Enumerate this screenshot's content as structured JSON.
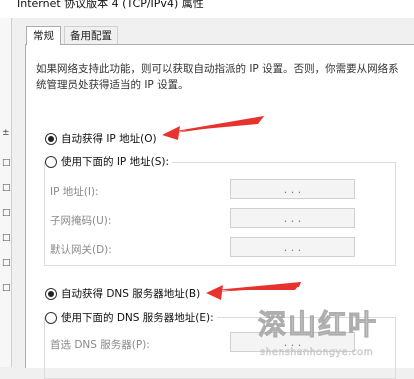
{
  "window": {
    "title": "Internet 协议版本 4 (TCP/IPv4) 属性"
  },
  "tabs": [
    {
      "label": "常规",
      "active": true
    },
    {
      "label": "备用配置",
      "active": false
    }
  ],
  "description": "如果网络支持此功能，则可以获取自动指派的 IP 设置。否则，你需要从网络系统管理员处获得适当的 IP 设置。",
  "ip": {
    "auto_label": "自动获得 IP 地址(O)",
    "auto_selected": true,
    "manual_label": "使用下面的 IP 地址(S):",
    "manual_selected": false,
    "fields": [
      {
        "label": "IP 地址(I):",
        "value": ". . ."
      },
      {
        "label": "子网掩码(U):",
        "value": ". . ."
      },
      {
        "label": "默认网关(D):",
        "value": ". . ."
      }
    ]
  },
  "dns": {
    "auto_label": "自动获得 DNS 服务器地址(B)",
    "auto_selected": true,
    "manual_label": "使用下面的 DNS 服务器地址(E):",
    "manual_selected": false,
    "fields": [
      {
        "label": "首选 DNS 服务器(P):",
        "value": ". . ."
      }
    ]
  },
  "watermark": {
    "logo_text": "深山红叶",
    "url": "shenshanhongye.com"
  },
  "colors": {
    "arrow": "#e8322d",
    "panel_bg": "#ffffff",
    "window_bg": "#f0f0f0"
  }
}
